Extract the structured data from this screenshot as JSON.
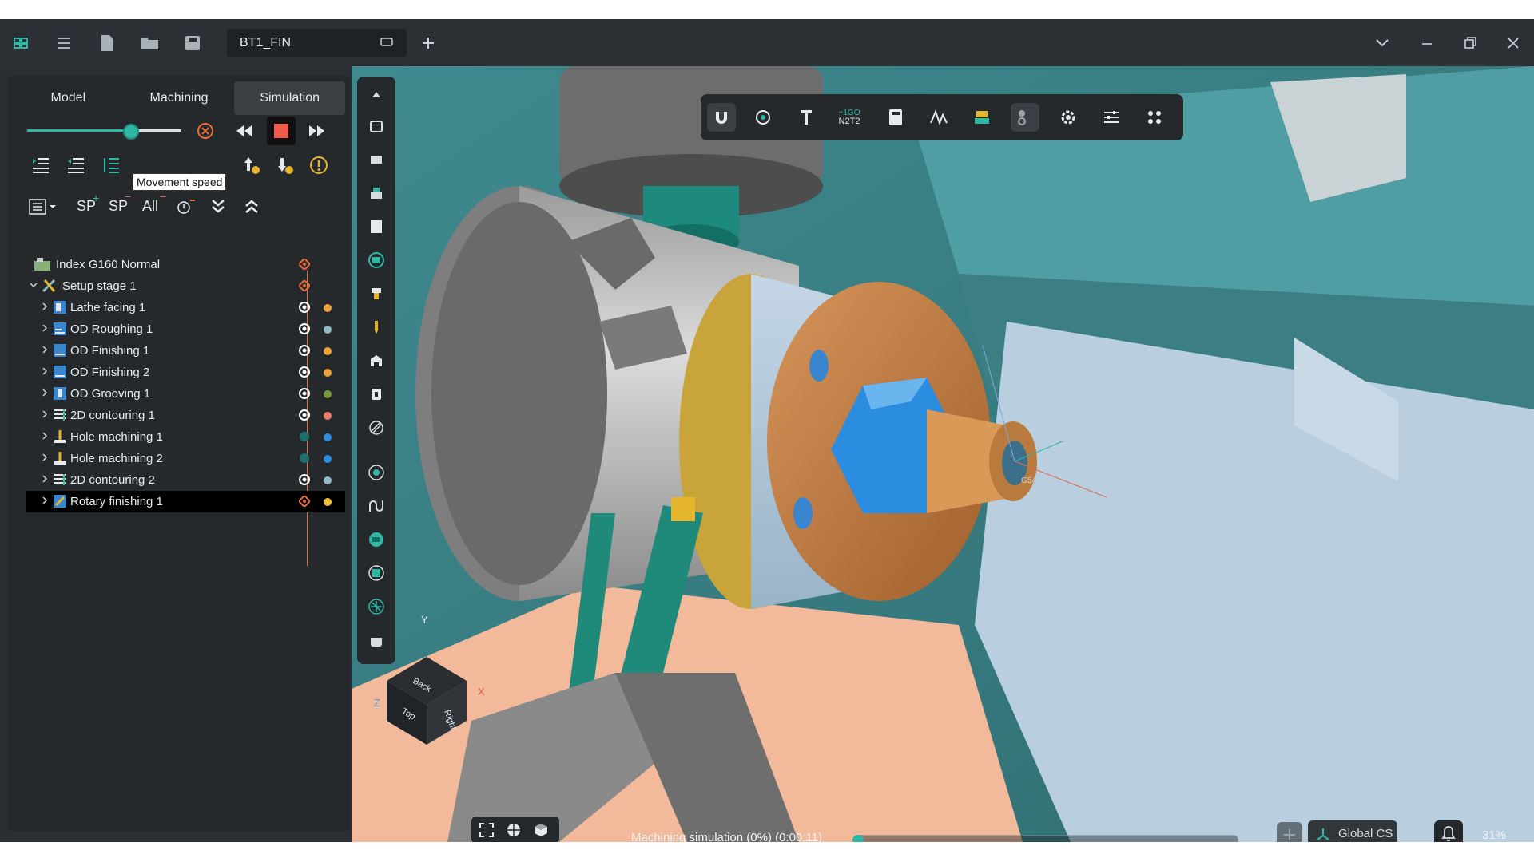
{
  "titlebar": {
    "doc_tab": "BT1_FIN",
    "icons": [
      "app-logo-icon",
      "menu-icon",
      "new-file-icon",
      "open-folder-icon",
      "save-icon"
    ]
  },
  "panel": {
    "tabs": [
      {
        "label": "Model",
        "active": false
      },
      {
        "label": "Machining",
        "active": false
      },
      {
        "label": "Simulation",
        "active": true
      }
    ],
    "movement_speed": 0.67,
    "tooltip": "Movement speed",
    "sp_add": "SP",
    "sp_remove": "SP",
    "all_label": "All",
    "tree": [
      {
        "label": "Index G160 Normal",
        "level": 0,
        "chevron": "none",
        "dot": null
      },
      {
        "label": "Setup stage 1",
        "level": 0,
        "chevron": "down",
        "dot": null
      },
      {
        "label": "Lathe facing 1",
        "level": 1,
        "chevron": "right",
        "dot": "#f0a23a"
      },
      {
        "label": "OD Roughing 1",
        "level": 1,
        "chevron": "right",
        "dot": "#8fb9c5"
      },
      {
        "label": "OD Finishing 1",
        "level": 1,
        "chevron": "right",
        "dot": "#f0a23a"
      },
      {
        "label": "OD Finishing 2",
        "level": 1,
        "chevron": "right",
        "dot": "#f0a23a"
      },
      {
        "label": "OD Grooving 1",
        "level": 1,
        "chevron": "right",
        "dot": "#7a9a3a"
      },
      {
        "label": "2D contouring 1",
        "level": 1,
        "chevron": "right",
        "dot": "#ee7b6a"
      },
      {
        "label": "Hole machining 1",
        "level": 1,
        "chevron": "right",
        "dot": "#2b8de0"
      },
      {
        "label": "Hole machining 2",
        "level": 1,
        "chevron": "right",
        "dot": "#2b8de0"
      },
      {
        "label": "2D contouring 2",
        "level": 1,
        "chevron": "right",
        "dot": "#8fb9c5"
      },
      {
        "label": "Rotary finishing 1",
        "level": 1,
        "chevron": "right",
        "dot": "#f5c33b",
        "selected": true
      }
    ]
  },
  "toptoolbar": {
    "gcode_label_top": "+1GO",
    "gcode_label_bottom": "N2T2"
  },
  "viewport": {
    "viewcube_faces": [
      "Back",
      "Top",
      "Right"
    ],
    "axes": [
      "Y",
      "Z",
      "X"
    ],
    "marker_label": "G54"
  },
  "statusbar": {
    "simulation_text": "Machining simulation (0%) (0:00:11)",
    "progress": 0.0,
    "coordinate_system": "Global CS",
    "zoom": "31%"
  },
  "colors": {
    "accent": "#2fb7a6",
    "orange_marker": "#ea6b3a"
  }
}
